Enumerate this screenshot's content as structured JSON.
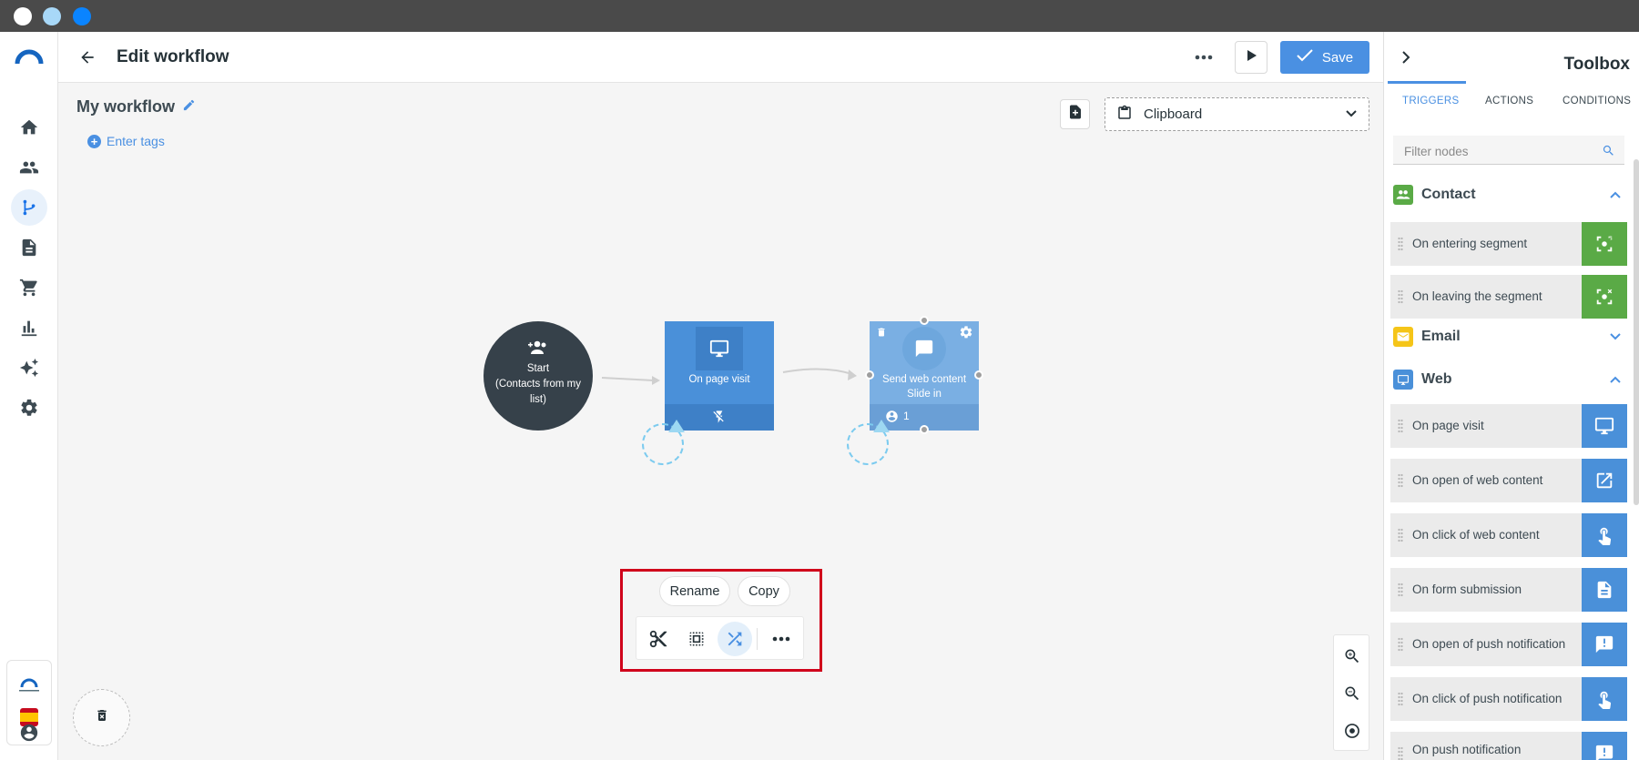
{
  "window": {
    "traffic_colors": [
      "#ffffff",
      "#a8d8f8",
      "#0a84ff"
    ]
  },
  "nav": {
    "items": [
      "home-icon",
      "contacts-icon",
      "workflow-icon",
      "document-icon",
      "cart-icon",
      "analytics-icon",
      "sparkles-icon",
      "settings-icon"
    ],
    "active": "workflow-icon",
    "user_icon": "account-circle-icon"
  },
  "header": {
    "title": "Edit workflow",
    "save_label": "Save"
  },
  "workflow": {
    "name": "My workflow",
    "enter_tags": "Enter tags",
    "clipboard_label": "Clipboard",
    "start_node": {
      "title": "Start",
      "subtitle": "(Contacts from my list)"
    },
    "nodes": [
      {
        "label": "On page visit",
        "icon": "monitor-icon",
        "footer_icon": "no-flash-icon"
      },
      {
        "label": "Send web content",
        "sublabel": "Slide in",
        "icon": "chat-bubble-icon",
        "count": "1"
      }
    ]
  },
  "selection_toolbar": {
    "rename_label": "Rename",
    "copy_label": "Copy",
    "tools": [
      "scissors-icon",
      "select-all-icon",
      "shuffle-icon",
      "more-icon"
    ],
    "active_tool": "shuffle-icon"
  },
  "toolbox": {
    "title": "Toolbox",
    "tabs": [
      "TRIGGERS",
      "ACTIONS",
      "CONDITIONS"
    ],
    "active_tab": "TRIGGERS",
    "filter_placeholder": "Filter nodes",
    "categories": [
      {
        "label": "Contact",
        "color": "#5aaa46",
        "expanded": true,
        "items": [
          {
            "label": "On entering segment",
            "icon": "segment-enter-icon"
          },
          {
            "label": "On leaving the segment",
            "icon": "segment-leave-icon"
          }
        ]
      },
      {
        "label": "Email",
        "color": "#f5c518",
        "expanded": false,
        "items": []
      },
      {
        "label": "Web",
        "color": "#4a90d9",
        "expanded": true,
        "items": [
          {
            "label": "On page visit",
            "icon": "monitor-icon"
          },
          {
            "label": "On open of web content",
            "icon": "open-external-icon"
          },
          {
            "label": "On click of web content",
            "icon": "tap-icon"
          },
          {
            "label": "On form submission",
            "icon": "document-icon"
          },
          {
            "label": "On open of push notification",
            "icon": "alert-message-icon"
          },
          {
            "label": "On click of push notification",
            "icon": "tap-icon"
          },
          {
            "label": "On push notification",
            "icon": "alert-message-icon"
          }
        ]
      }
    ]
  }
}
